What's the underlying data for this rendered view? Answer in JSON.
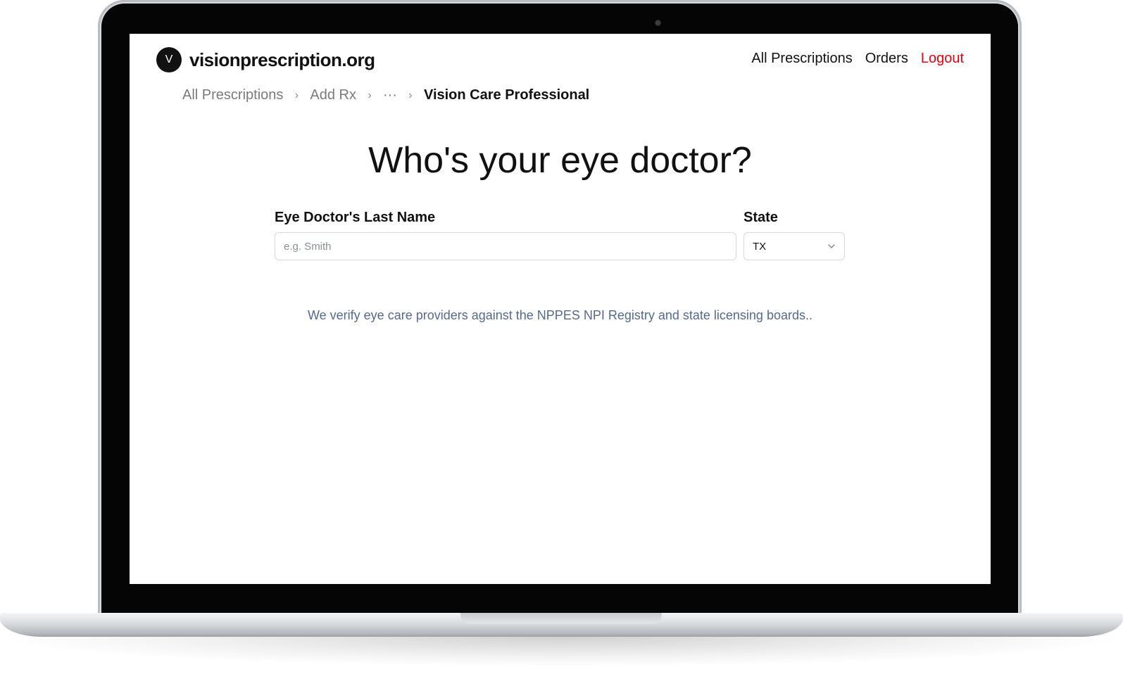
{
  "header": {
    "logo_letter": "V",
    "site_name": "visionprescription.org",
    "nav": {
      "all_prescriptions": "All Prescriptions",
      "orders": "Orders",
      "logout": "Logout"
    }
  },
  "breadcrumb": {
    "items": [
      "All Prescriptions",
      "Add Rx",
      "···"
    ],
    "current": "Vision Care Professional",
    "separator": "›"
  },
  "main": {
    "title": "Who's your eye doctor?",
    "last_name": {
      "label": "Eye Doctor's Last Name",
      "placeholder": "e.g. Smith",
      "value": ""
    },
    "state": {
      "label": "State",
      "selected": "TX"
    },
    "info": "We verify eye care providers against the NPPES NPI Registry and state licensing boards.."
  },
  "colors": {
    "logout": "#e0000f",
    "info_text": "#56698a",
    "text": "#111111"
  },
  "icons": {
    "state_dropdown": "chevron-down-icon",
    "breadcrumb_separator": "chevron-right-icon"
  }
}
